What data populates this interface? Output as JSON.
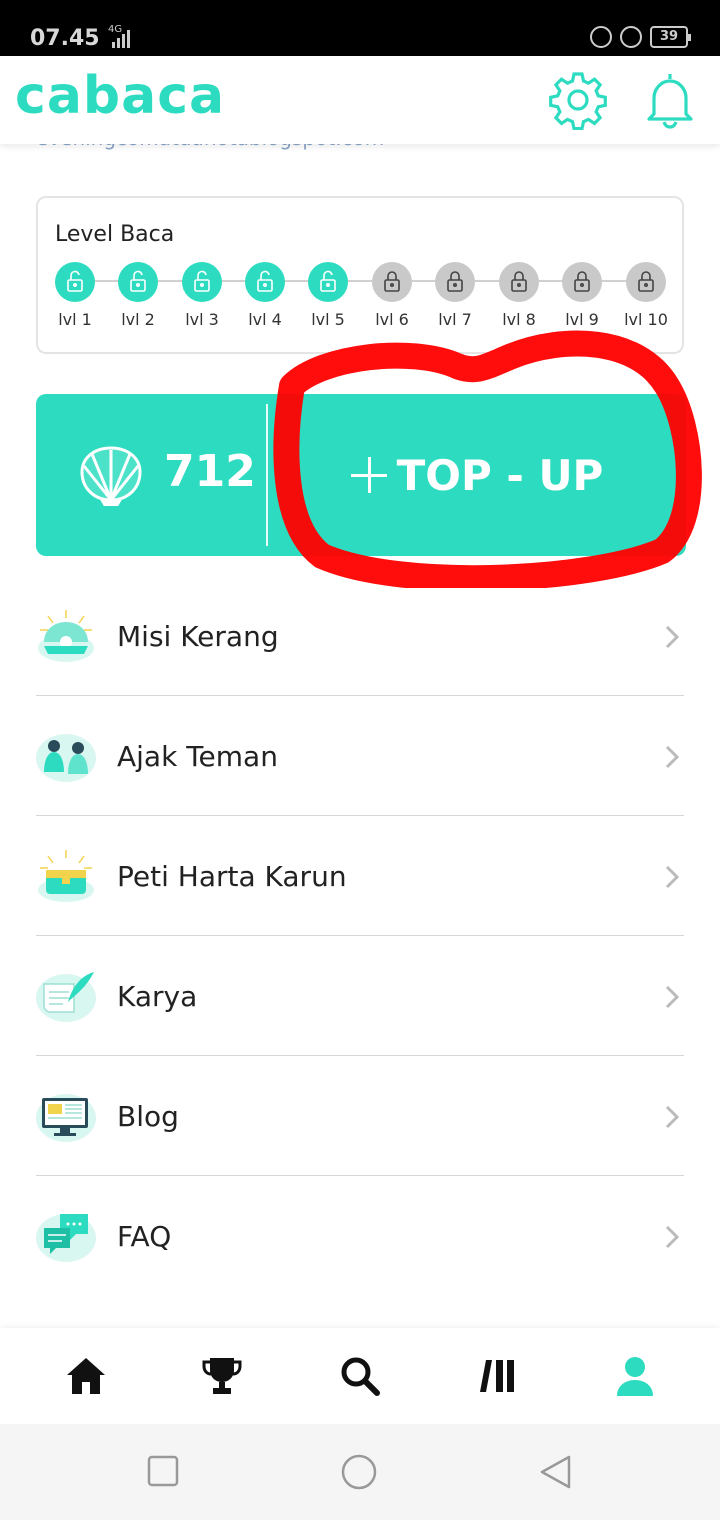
{
  "status_bar": {
    "time": "07.45",
    "network": "4G",
    "battery": "39"
  },
  "header": {
    "logo": "cabaca"
  },
  "partial_link": "eveningcomatdanotablogspot.com",
  "level_card": {
    "title": "Level Baca",
    "levels": [
      {
        "label": "lvl 1",
        "unlocked": true
      },
      {
        "label": "lvl 2",
        "unlocked": true
      },
      {
        "label": "lvl 3",
        "unlocked": true
      },
      {
        "label": "lvl 4",
        "unlocked": true
      },
      {
        "label": "lvl 5",
        "unlocked": true
      },
      {
        "label": "lvl 6",
        "unlocked": false
      },
      {
        "label": "lvl 7",
        "unlocked": false
      },
      {
        "label": "lvl 8",
        "unlocked": false
      },
      {
        "label": "lvl 9",
        "unlocked": false
      },
      {
        "label": "lvl 10",
        "unlocked": false
      }
    ]
  },
  "wallet": {
    "shell_count": "712",
    "topup_label": "TOP - UP"
  },
  "menu": {
    "items": [
      {
        "label": "Misi Kerang",
        "icon": "clam-pearl-icon"
      },
      {
        "label": "Ajak Teman",
        "icon": "friends-icon"
      },
      {
        "label": "Peti Harta Karun",
        "icon": "treasure-chest-icon"
      },
      {
        "label": "Karya",
        "icon": "quill-paper-icon"
      },
      {
        "label": "Blog",
        "icon": "monitor-icon"
      },
      {
        "label": "FAQ",
        "icon": "chat-bubbles-icon"
      }
    ]
  },
  "colors": {
    "accent": "#2ddcc0",
    "annotation": "#ff0000",
    "locked": "#c9c9c9"
  },
  "bottom_nav": [
    "home-icon",
    "trophy-icon",
    "search-icon",
    "library-icon",
    "profile-icon"
  ],
  "active_tab": "profile-icon"
}
